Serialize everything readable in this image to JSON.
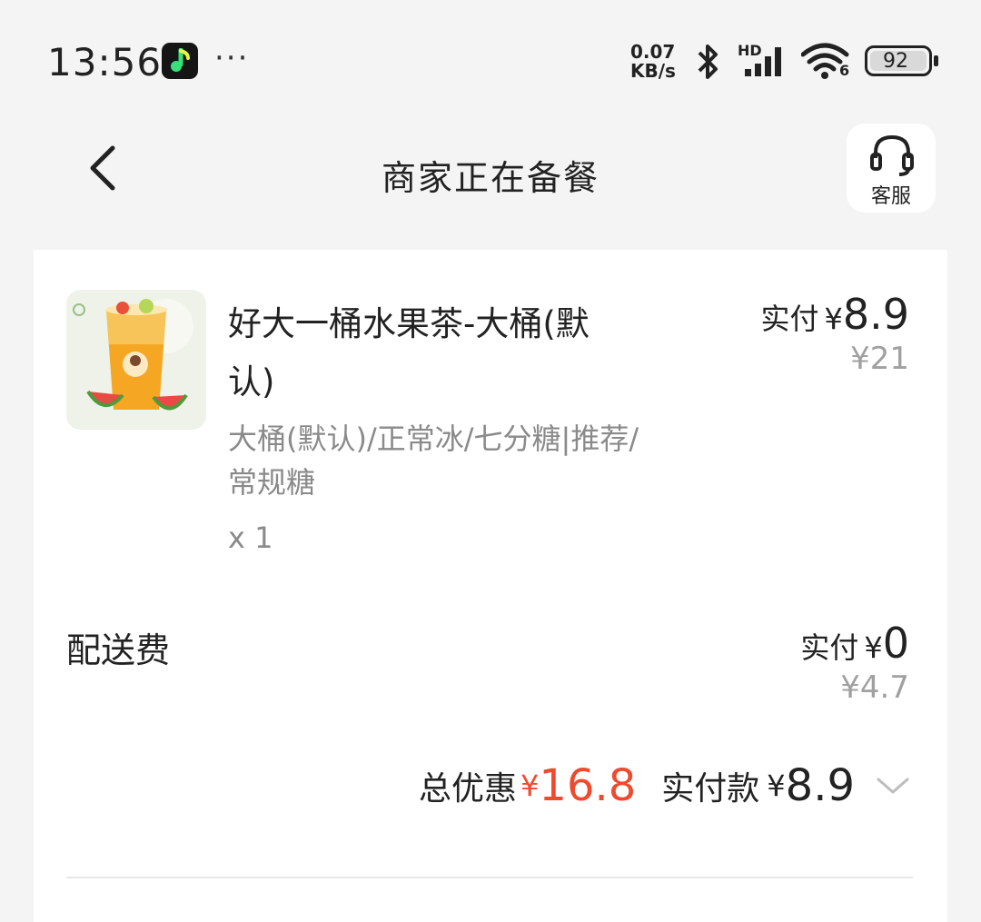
{
  "status_bar": {
    "time": "13:56",
    "net_speed_value": "0.07",
    "net_speed_unit": "KB/s",
    "signal_label": "HD",
    "wifi_label": "6",
    "battery": "92"
  },
  "nav": {
    "title": "商家正在备餐",
    "service_label": "客服"
  },
  "order": {
    "item": {
      "name": "好大一桶水果茶-大桶(默认)",
      "specs": "大桶(默认)/正常冰/七分糖|推荐/常规糖",
      "qty": "x 1",
      "paid_label": "实付",
      "currency": "¥",
      "paid": "8.9",
      "original": "¥21"
    },
    "delivery": {
      "label": "配送费",
      "paid_label": "实付",
      "currency": "¥",
      "paid": "0",
      "original": "¥4.7"
    },
    "summary": {
      "discount_label": "总优惠",
      "discount_currency": "¥",
      "discount": "16.8",
      "paid_label": "实付款",
      "paid_currency": "¥",
      "paid": "8.9"
    }
  },
  "colors": {
    "accent_red": "#f04a2e",
    "background": "#f4f4f4",
    "card": "#ffffff"
  }
}
